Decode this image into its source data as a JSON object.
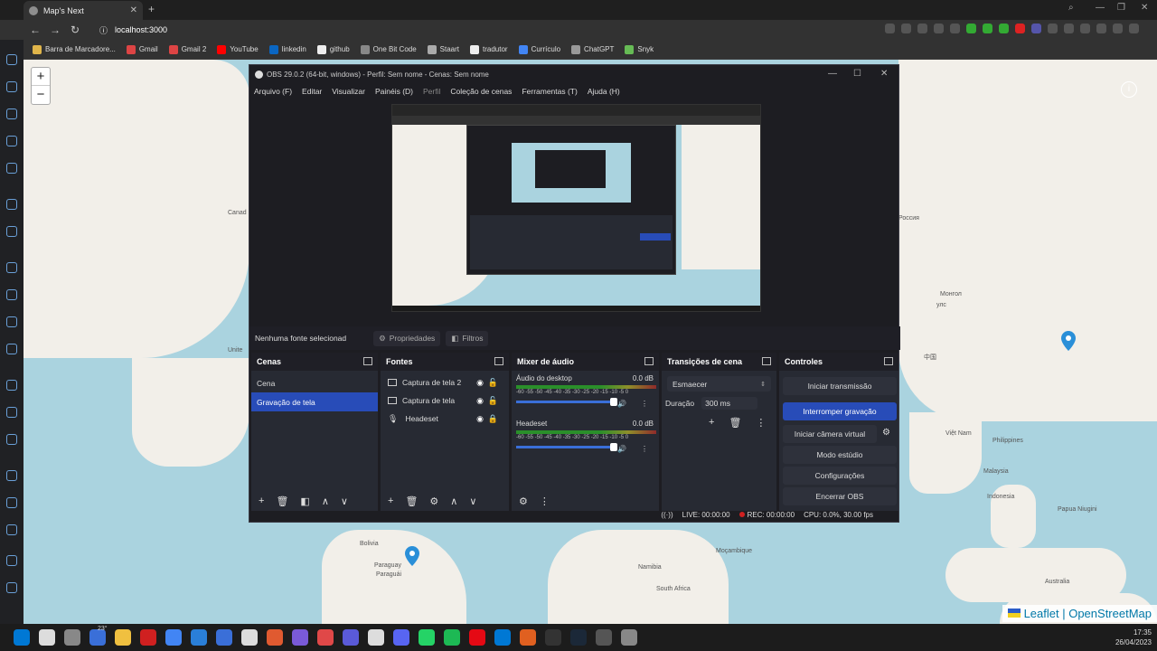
{
  "browser": {
    "tab_title": "Map's Next",
    "url": "localhost:3000",
    "bookmarks": [
      "Barra de Marcadore...",
      "Gmail",
      "Gmail 2",
      "YouTube",
      "linkedin",
      "github",
      "One Bit Code",
      "Staart",
      "tradutor",
      "Currículo",
      "ChatGPT",
      "Snyk"
    ],
    "bookmark_colors": [
      "#e0b54a",
      "#d44",
      "#d44",
      "#f00",
      "#0a66c2",
      "#eee",
      "#888",
      "#aaa",
      "#eee",
      "#4285f4",
      "#999",
      "#6b5"
    ]
  },
  "map": {
    "labels": [
      "Canad",
      "Unite",
      "Россия",
      "Монгол",
      "улс",
      "中国",
      "Việt Nam",
      "Philippines",
      "Malaysia",
      "Indonesia",
      "Papua Niugini",
      "Bolivia",
      "Paraguay",
      "Paraguái",
      "Moçambique",
      "Namibia",
      "South Africa",
      "Australia"
    ],
    "attribution_left": "Leaflet",
    "attribution_right": "OpenStreetMap"
  },
  "obs": {
    "title": "OBS 29.0.2 (64-bit, windows) - Perfil: Sem nome - Cenas: Sem nome",
    "menu": [
      "Arquivo (F)",
      "Editar",
      "Visualizar",
      "Painéis (D)",
      "Perfil",
      "Coleção de cenas",
      "Ferramentas (T)",
      "Ajuda (H)"
    ],
    "no_source": "Nenhuma fonte selecionad",
    "properties": "Propriedades",
    "filters": "Filtros",
    "scenes_title": "Cenas",
    "scenes": [
      "Cena",
      "Gravação de tela"
    ],
    "sources_title": "Fontes",
    "sources": [
      "Captura de tela 2",
      "Captura de tela",
      "Headeset"
    ],
    "mixer_title": "Mixer de áudio",
    "mixer": [
      {
        "name": "Áudio do desktop",
        "db": "0.0 dB"
      },
      {
        "name": "Headeset",
        "db": "0.0 dB"
      }
    ],
    "mixer_scale": "-60 -55 -50 -45 -40 -35 -30 -25 -20 -15 -10 -5 0",
    "transitions_title": "Transições de cena",
    "transition": "Esmaecer",
    "duration_label": "Duração",
    "duration_value": "300 ms",
    "controls_title": "Controles",
    "controls": [
      "Iniciar transmissão",
      "Interromper gravação",
      "Iniciar câmera virtual",
      "Modo estúdio",
      "Configurações",
      "Encerrar OBS"
    ],
    "status_live": "LIVE: 00:00:00",
    "status_rec": "REC: 00:00:00",
    "status_cpu": "CPU: 0.0%, 30.00 fps"
  },
  "taskbar": {
    "weather": "23°",
    "time": "17:35",
    "date": "26/04/2023",
    "icon_colors": [
      "#0078d4",
      "#ddd",
      "#888",
      "#3a6fd8",
      "#f0c040",
      "#d02020",
      "#4285f4",
      "#2a7fd8",
      "#3a6fd8",
      "#ddd",
      "#e05a30",
      "#7a5ad8",
      "#e04848",
      "#5a5ad8",
      "#ddd",
      "#5865f2",
      "#25d366",
      "#1db954",
      "#e50914",
      "#0078d4",
      "#e06020",
      "#333",
      "#1b2838",
      "#555",
      "#888"
    ]
  }
}
